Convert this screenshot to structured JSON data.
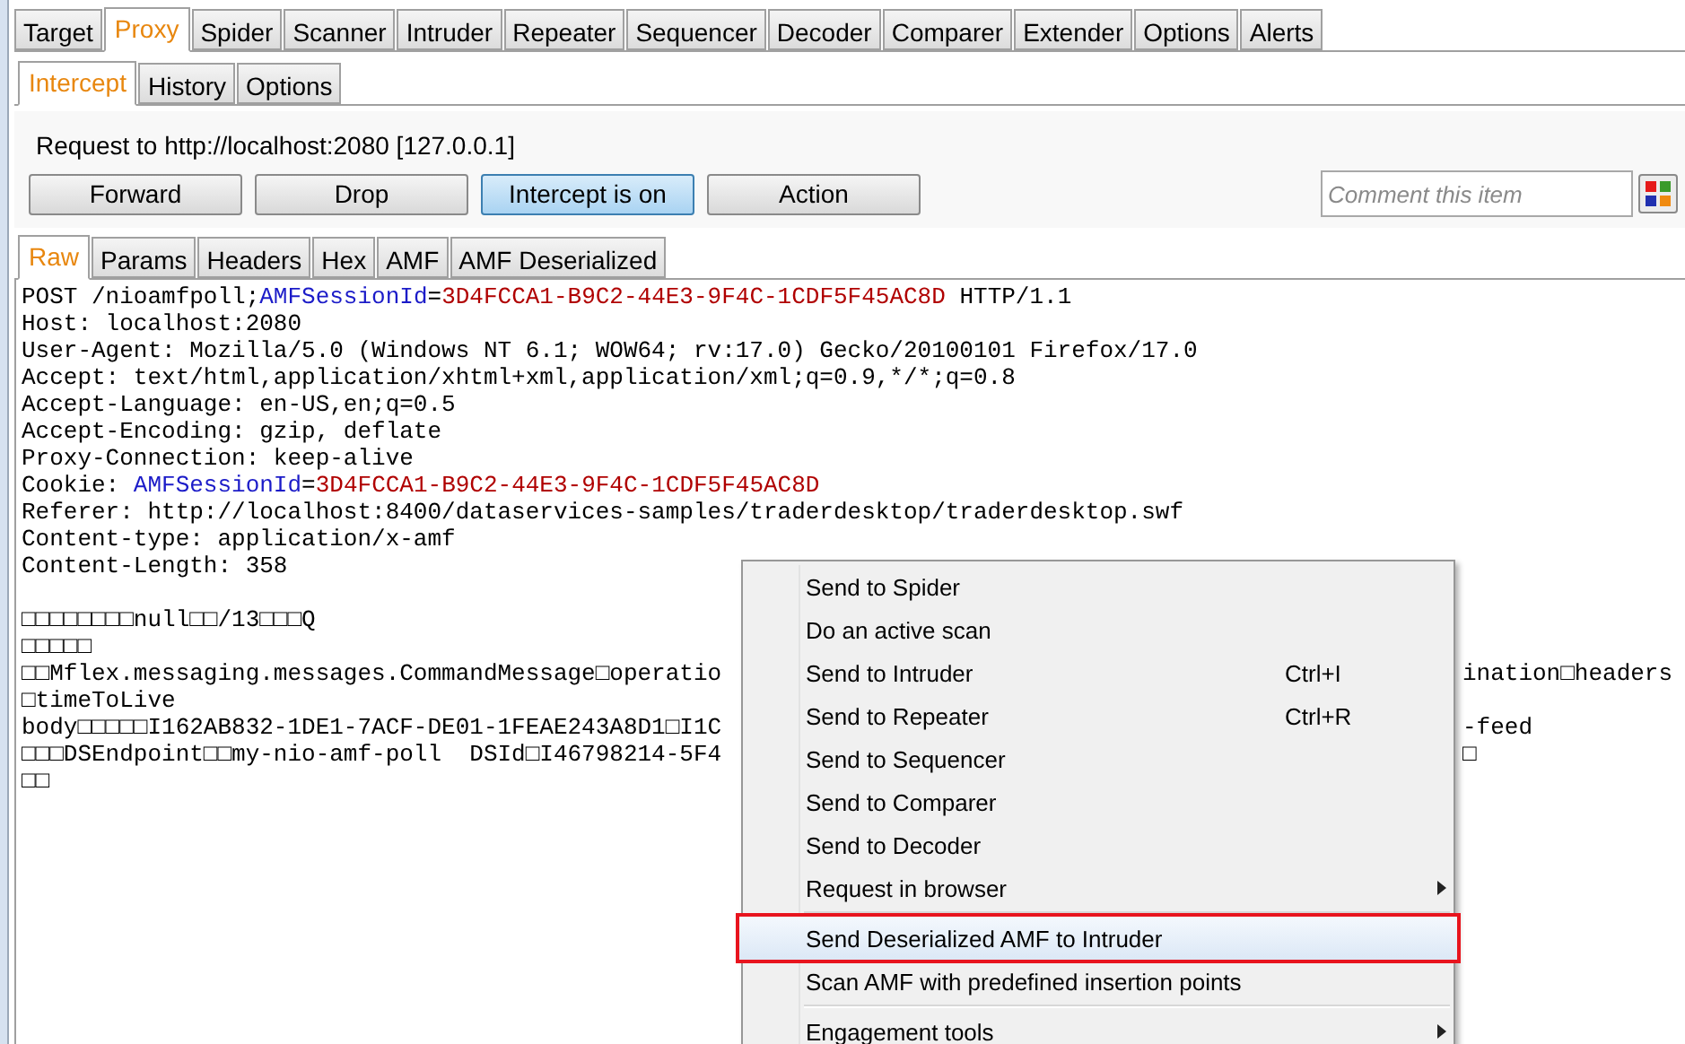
{
  "main_tabs": [
    {
      "label": "Target",
      "selected": false
    },
    {
      "label": "Proxy",
      "selected": true
    },
    {
      "label": "Spider",
      "selected": false
    },
    {
      "label": "Scanner",
      "selected": false
    },
    {
      "label": "Intruder",
      "selected": false
    },
    {
      "label": "Repeater",
      "selected": false
    },
    {
      "label": "Sequencer",
      "selected": false
    },
    {
      "label": "Decoder",
      "selected": false
    },
    {
      "label": "Comparer",
      "selected": false
    },
    {
      "label": "Extender",
      "selected": false
    },
    {
      "label": "Options",
      "selected": false
    },
    {
      "label": "Alerts",
      "selected": false
    }
  ],
  "proxy_tabs": [
    {
      "label": "Intercept",
      "selected": true
    },
    {
      "label": "History",
      "selected": false
    },
    {
      "label": "Options",
      "selected": false
    }
  ],
  "request_info": "Request to http://localhost:2080  [127.0.0.1]",
  "buttons": [
    {
      "label": "Forward",
      "pressed": false
    },
    {
      "label": "Drop",
      "pressed": false
    },
    {
      "label": "Intercept is on",
      "pressed": true
    },
    {
      "label": "Action",
      "pressed": false
    }
  ],
  "comment": {
    "placeholder": "Comment this item"
  },
  "editor_tabs": [
    {
      "label": "Raw",
      "selected": true
    },
    {
      "label": "Params",
      "selected": false
    },
    {
      "label": "Headers",
      "selected": false
    },
    {
      "label": "Hex",
      "selected": false
    },
    {
      "label": "AMF",
      "selected": false
    },
    {
      "label": "AMF Deserialized",
      "selected": false
    }
  ],
  "header_lines": [
    [
      {
        "text": "POST /nioamfpoll;",
        "kind": "plain"
      },
      {
        "text": "AMFSessionId",
        "kind": "name"
      },
      {
        "text": "=",
        "kind": "plain"
      },
      {
        "text": "3D4FCCA1-B9C2-44E3-9F4C-1CDF5F45AC8D",
        "kind": "value"
      },
      {
        "text": " HTTP/1.1",
        "kind": "plain"
      }
    ],
    [
      {
        "text": "Host: localhost:2080",
        "kind": "plain"
      }
    ],
    [
      {
        "text": "User-Agent: Mozilla/5.0 (Windows NT 6.1; WOW64; rv:17.0) Gecko/20100101 Firefox/17.0",
        "kind": "plain"
      }
    ],
    [
      {
        "text": "Accept: text/html,application/xhtml+xml,application/xml;q=0.9,*/*;q=0.8",
        "kind": "plain"
      }
    ],
    [
      {
        "text": "Accept-Language: en-US,en;q=0.5",
        "kind": "plain"
      }
    ],
    [
      {
        "text": "Accept-Encoding: gzip, deflate",
        "kind": "plain"
      }
    ],
    [
      {
        "text": "Proxy-Connection: keep-alive",
        "kind": "plain"
      }
    ],
    [
      {
        "text": "Cookie: ",
        "kind": "plain"
      },
      {
        "text": "AMFSessionId",
        "kind": "name"
      },
      {
        "text": "=",
        "kind": "plain"
      },
      {
        "text": "3D4FCCA1-B9C2-44E3-9F4C-1CDF5F45AC8D",
        "kind": "value"
      }
    ],
    [
      {
        "text": "Referer: http://localhost:8400/dataservices-samples/traderdesktop/traderdesktop.swf",
        "kind": "plain"
      }
    ],
    [
      {
        "text": "Content-type: application/x-amf",
        "kind": "plain"
      }
    ],
    [
      {
        "text": "Content-Length: 358",
        "kind": "plain"
      }
    ]
  ],
  "body_lines": [
    {
      "left": "□□□□□□□□null□□/13□□□Q"
    },
    {
      "left": "□□□□□"
    },
    {
      "left": "□□Mflex.messaging.messages.CommandMessage□operatio",
      "right": "ination□headers"
    },
    {
      "left": "□timeToLive"
    },
    {
      "left": "body□□□□□I162AB832-1DE1-7ACF-DE01-1FEAE243A8D1□I1C",
      "right": "-feed"
    },
    {
      "left": "□□□DSEndpoint□□my-nio-amf-poll  DSId□I46798214-5F4",
      "right": "□"
    },
    {
      "left": "□□"
    }
  ],
  "context_menu": [
    {
      "kind": "item",
      "label": "Send to Spider",
      "highlighted": false
    },
    {
      "kind": "item",
      "label": "Do an active scan",
      "highlighted": false
    },
    {
      "kind": "item",
      "label": "Send to Intruder",
      "shortcut": "Ctrl+I",
      "highlighted": false
    },
    {
      "kind": "item",
      "label": "Send to Repeater",
      "shortcut": "Ctrl+R",
      "highlighted": false
    },
    {
      "kind": "item",
      "label": "Send to Sequencer",
      "highlighted": false
    },
    {
      "kind": "item",
      "label": "Send to Comparer",
      "highlighted": false
    },
    {
      "kind": "item",
      "label": "Send to Decoder",
      "highlighted": false
    },
    {
      "kind": "submenu",
      "label": "Request in browser",
      "highlighted": false
    },
    {
      "kind": "separator"
    },
    {
      "kind": "item",
      "label": "Send Deserialized AMF to Intruder",
      "highlighted": true
    },
    {
      "kind": "item",
      "label": "Scan AMF with predefined insertion points",
      "highlighted": false
    },
    {
      "kind": "separator"
    },
    {
      "kind": "submenu",
      "label": "Engagement tools",
      "highlighted": false
    }
  ]
}
